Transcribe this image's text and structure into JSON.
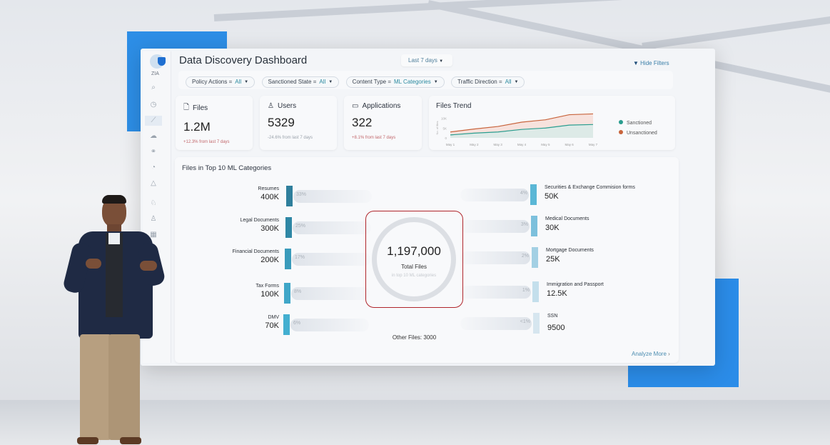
{
  "app": {
    "logo": "ZIA",
    "title": "Data Discovery Dashboard"
  },
  "date_range": {
    "label": "Last 7 days"
  },
  "hide_filters": "Hide Filters",
  "filters": [
    {
      "key": "Policy Actions =",
      "value": "All"
    },
    {
      "key": "Sanctioned State =",
      "value": "All"
    },
    {
      "key": "Content Type =",
      "value": "ML Categories"
    },
    {
      "key": "Traffic Direction =",
      "value": "All"
    }
  ],
  "sidebar": {
    "icons": [
      "search-icon",
      "gauge-icon",
      "chart-icon",
      "cloud-icon",
      "link-icon",
      "clock-icon",
      "alert-icon",
      "bell-icon",
      "user-icon",
      "grid-icon"
    ],
    "active": "chart-icon"
  },
  "kpis": [
    {
      "title": "Files",
      "icon": "file-icon",
      "value": "1.2M",
      "delta": "+12.3% from last 7 days",
      "delta_color": "#c2676b"
    },
    {
      "title": "Users",
      "icon": "user-icon",
      "value": "5329",
      "delta": "-24.6% from last 7 days",
      "delta_color": "#9aa2ab"
    },
    {
      "title": "Applications",
      "icon": "window-icon",
      "value": "322",
      "delta": "+8.1% from last 7 days",
      "delta_color": "#c2676b"
    }
  ],
  "trend": {
    "title": "Files Trend",
    "chart_data": {
      "type": "area",
      "ylabel": "No. of files",
      "y_ticks": [
        "0",
        "5K",
        "10K"
      ],
      "ylim": [
        0,
        12000
      ],
      "categories": [
        "May 1",
        "May 2",
        "May 3",
        "May 4",
        "May 5",
        "May 6",
        "May 7"
      ],
      "series": [
        {
          "name": "Sanctioned",
          "color": "#2a9d8f",
          "values": [
            1500,
            2400,
            3000,
            4300,
            5000,
            6500,
            6800
          ]
        },
        {
          "name": "Unsanctioned",
          "color": "#c8643c",
          "values": [
            3000,
            4500,
            5800,
            8000,
            9200,
            11800,
            12200
          ]
        }
      ],
      "legend": "right"
    }
  },
  "categories_panel": {
    "title": "Files in Top 10 ML Categories",
    "left": [
      {
        "label": "Resumes",
        "value": "400K",
        "pct": "33%",
        "color": "#2f7f9c"
      },
      {
        "label": "Legal Documents",
        "value": "300K",
        "pct": "25%",
        "color": "#2f87a5"
      },
      {
        "label": "Financial Documents",
        "value": "200K",
        "pct": "17%",
        "color": "#3a9bbb"
      },
      {
        "label": "Tax Forms",
        "value": "100K",
        "pct": "8%",
        "color": "#3fa6c8"
      },
      {
        "label": "DMV",
        "value": "70K",
        "pct": "6%",
        "color": "#43afd0"
      }
    ],
    "right": [
      {
        "label": "Securities & Exchange Commision forms",
        "value": "50K",
        "pct": "4%",
        "color": "#5ab7d6"
      },
      {
        "label": "Medical Documents",
        "value": "30K",
        "pct": "3%",
        "color": "#7cc0dc"
      },
      {
        "label": "Mortgage Documents",
        "value": "25K",
        "pct": "2%",
        "color": "#a3d0e4"
      },
      {
        "label": "Immigration and Passport",
        "value": "12.5K",
        "pct": "1%",
        "color": "#c4dfec"
      },
      {
        "label": "SSN",
        "value": "9500",
        "pct": "<1%",
        "color": "#d6e6ef"
      }
    ],
    "total": {
      "value": "1,197,000",
      "label": "Total Files",
      "sub": "in top 10 ML categories",
      "highlight": "#b0252b"
    },
    "other": "Other Files: 3000",
    "analyze_more": "Analyze More"
  }
}
